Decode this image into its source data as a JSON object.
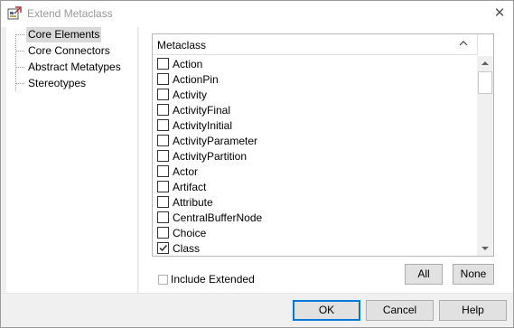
{
  "window": {
    "title": "Extend Metaclass",
    "app_icon": "ea-app-icon",
    "close_glyph": "✕"
  },
  "tree": {
    "items": [
      {
        "label": "Core Elements",
        "selected": true
      },
      {
        "label": "Core Connectors",
        "selected": false
      },
      {
        "label": "Abstract Metatypes",
        "selected": false
      },
      {
        "label": "Stereotypes",
        "selected": false
      }
    ]
  },
  "list": {
    "column_header": "Metaclass",
    "sort_icon": "chevron-up-icon",
    "rows": [
      {
        "label": "Action",
        "checked": false
      },
      {
        "label": "ActionPin",
        "checked": false
      },
      {
        "label": "Activity",
        "checked": false
      },
      {
        "label": "ActivityFinal",
        "checked": false
      },
      {
        "label": "ActivityInitial",
        "checked": false
      },
      {
        "label": "ActivityParameter",
        "checked": false
      },
      {
        "label": "ActivityPartition",
        "checked": false
      },
      {
        "label": "Actor",
        "checked": false
      },
      {
        "label": "Artifact",
        "checked": false
      },
      {
        "label": "Attribute",
        "checked": false
      },
      {
        "label": "CentralBufferNode",
        "checked": false
      },
      {
        "label": "Choice",
        "checked": false
      },
      {
        "label": "Class",
        "checked": true
      }
    ]
  },
  "options": {
    "include_extended_label": "Include Extended",
    "include_extended_checked": false
  },
  "buttons": {
    "all": "All",
    "none": "None",
    "ok": "OK",
    "cancel": "Cancel",
    "help": "Help"
  },
  "colors": {
    "default_button_border": "#0078d7",
    "tree_selection": "#d9d9d9"
  }
}
